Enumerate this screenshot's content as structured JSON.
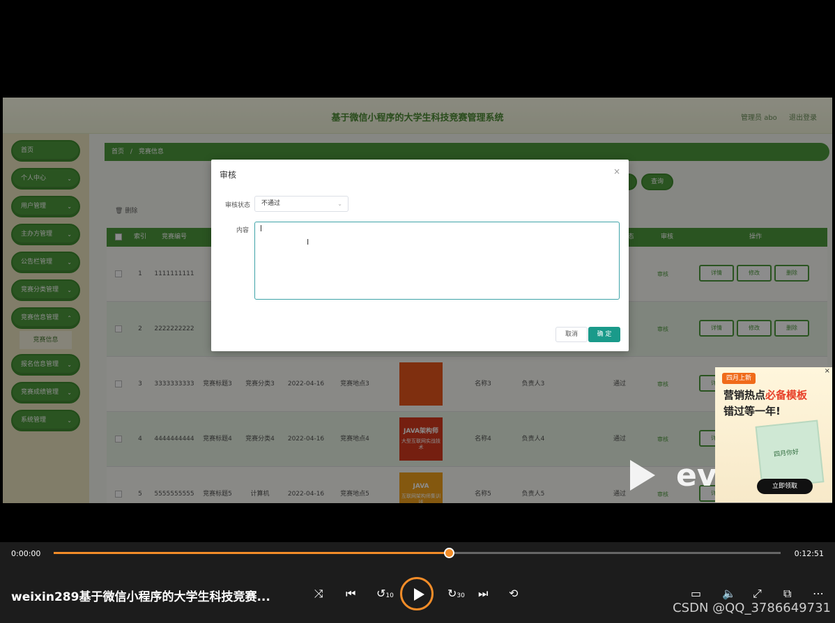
{
  "app": {
    "title": "基于微信小程序的大学生科技竞赛管理系统",
    "user": "管理员 abo",
    "logout": "退出登录"
  },
  "sidebar": {
    "items": [
      {
        "label": "首页"
      },
      {
        "label": "个人中心"
      },
      {
        "label": "用户管理"
      },
      {
        "label": "主办方管理"
      },
      {
        "label": "公告栏管理"
      },
      {
        "label": "竞赛分类管理"
      },
      {
        "label": "竞赛信息管理"
      },
      {
        "label": "报名信息管理"
      },
      {
        "label": "竞赛成绩管理"
      },
      {
        "label": "系统管理"
      }
    ],
    "sub_active": "竞赛信息"
  },
  "breadcrumb": {
    "home": "首页",
    "sep": "/",
    "current": "竞赛信息"
  },
  "toolbar": {
    "query": "查询",
    "delete": "删除"
  },
  "table": {
    "headers": {
      "index": "索引",
      "number": "竞赛编号",
      "audit_state": "态",
      "audit": "审核",
      "ops": "操作"
    },
    "rows": [
      {
        "index": "1",
        "number": "1111111111",
        "title": "竞",
        "category": "",
        "date": "",
        "place": "",
        "name": "",
        "owner": "",
        "status": ""
      },
      {
        "index": "2",
        "number": "2222222222",
        "title": "竞",
        "category": "",
        "date": "",
        "place": "",
        "name": "",
        "owner": "",
        "status": ""
      },
      {
        "index": "3",
        "number": "3333333333",
        "title": "竞赛标题3",
        "category": "竞赛分类3",
        "date": "2022-04-16",
        "place": "竞赛地点3",
        "name": "名称3",
        "owner": "负责人3",
        "status": "通过"
      },
      {
        "index": "4",
        "number": "4444444444",
        "title": "竞赛标题4",
        "category": "竞赛分类4",
        "date": "2022-04-16",
        "place": "竞赛地点4",
        "name": "名称4",
        "owner": "负责人4",
        "status": "通过"
      },
      {
        "index": "5",
        "number": "5555555555",
        "title": "竞赛标题5",
        "category": "计算机",
        "date": "2022-04-16",
        "place": "竞赛地点5",
        "name": "名称5",
        "owner": "负责人5",
        "status": "通过"
      }
    ],
    "audit_link": "审核",
    "op_detail": "详情",
    "op_edit": "修改",
    "op_delete": "删除",
    "thumb3": "",
    "thumb4_line1": "JAVA架构师",
    "thumb4_line2": "大型互联网实战技术",
    "thumb5_line1": "JAVA",
    "thumb5_line2": "互联网架构师集训班"
  },
  "dialog": {
    "title": "审核",
    "close": "×",
    "status_label": "审核状态",
    "status_value": "不通过",
    "content_label": "内容",
    "cancel": "取消",
    "confirm": "确 定"
  },
  "watermark": {
    "ev_text": "ev剪辑"
  },
  "ad": {
    "tag": "四月上新",
    "line1_a": "营销热点",
    "line1_b": "必备模板",
    "line2": "错过等一年!",
    "poster": "四月你好",
    "cta": "立即领取",
    "close": "×"
  },
  "player": {
    "current_time": "0:00:00",
    "total_time": "0:12:51",
    "progress": 0.545,
    "title": "weixin289基于微信小程序的大学生科技竞赛...",
    "skip_back": "10",
    "skip_forward": "30",
    "csdn": "CSDN @QQ_3786649731"
  },
  "colors": {
    "accent": "#4e9a3d",
    "player_accent": "#f28c28",
    "dialog_ok": "#1a9a8a"
  }
}
